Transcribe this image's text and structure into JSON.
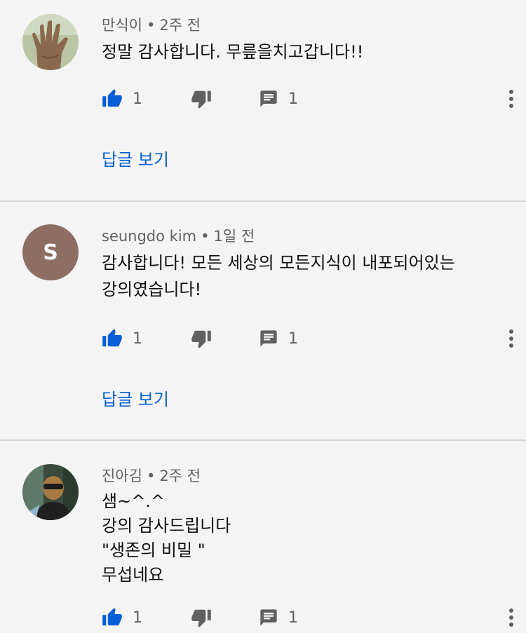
{
  "colors": {
    "like_blue": "#065fd4",
    "icon_gray": "#606060",
    "background": "#f4f4f4"
  },
  "comments": [
    {
      "author": "만식이",
      "time": "2주 전",
      "avatar_type": "photo",
      "avatar_icon": "hand-photo-avatar",
      "lines": [
        "정말 감사합니다. 무릎을치고갑니다!!"
      ],
      "likes": "1",
      "replies_count": "1",
      "view_replies": "답글 보기"
    },
    {
      "author": "seungdo kim",
      "time": "1일 전",
      "avatar_type": "letter",
      "avatar_letter": "S",
      "lines": [
        "감사합니다! 모든 세상의 모든지식이 내포되어있는",
        "강의였습니다!"
      ],
      "likes": "1",
      "replies_count": "1",
      "view_replies": "답글 보기"
    },
    {
      "author": "진아김",
      "time": "2주 전",
      "avatar_type": "photo",
      "avatar_icon": "person-photo-avatar",
      "lines": [
        "샘~^.^",
        "강의 감사드립니다",
        "\"생존의 비밀 \"",
        "무섭네요"
      ],
      "likes": "1",
      "replies_count": "1"
    }
  ],
  "separator": "•"
}
